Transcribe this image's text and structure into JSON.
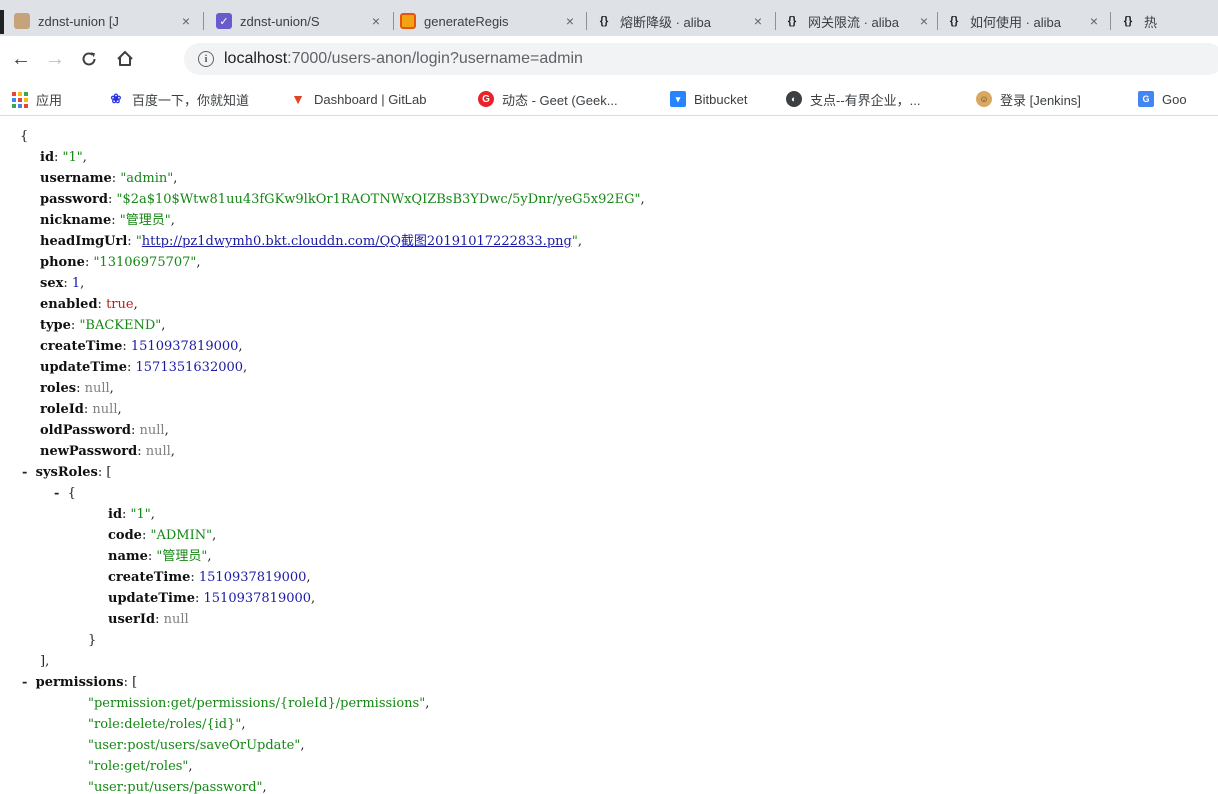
{
  "tabs": [
    {
      "title": "zdnst-union [J",
      "close": "×"
    },
    {
      "title": "zdnst-union/S",
      "close": "×"
    },
    {
      "title": "generateRegis",
      "close": "×"
    },
    {
      "title": "熔断降级 · aliba",
      "close": "×"
    },
    {
      "title": "网关限流 · aliba",
      "close": "×"
    },
    {
      "title": "如何使用 · aliba",
      "close": "×"
    },
    {
      "title": "热"
    }
  ],
  "toolbar": {
    "back_glyph": "←",
    "forward_glyph": "→",
    "reload_glyph": "C",
    "home_glyph": "⌂",
    "url_host": "localhost",
    "url_path": ":7000/users-anon/login?username=admin"
  },
  "bookmarks": [
    {
      "label": "应用",
      "icon": "apps-grid-icon"
    },
    {
      "label": "百度一下，你就知道",
      "icon": "baidu-paw-icon"
    },
    {
      "label": "Dashboard | GitLab",
      "icon": "gitlab-fox-icon"
    },
    {
      "label": "动态 - Geet (Geek...",
      "icon": "geet-icon"
    },
    {
      "label": "Bitbucket",
      "icon": "bitbucket-icon"
    },
    {
      "label": "支点--有界企业，...",
      "icon": "zhidian-icon"
    },
    {
      "label": "登录 [Jenkins]",
      "icon": "jenkins-icon"
    },
    {
      "label": "Goo",
      "icon": "google-translate-icon"
    }
  ],
  "json": {
    "open_brace": "{",
    "id_key": "id",
    "id_val": "\"1\"",
    "username_key": "username",
    "username_val": "\"admin\"",
    "password_key": "password",
    "password_val": "\"$2a$10$Wtw81uu43fGKw9lkOr1RAOTNWxQIZBsB3YDwc/5yDnr/yeG5x92EG\"",
    "nickname_key": "nickname",
    "nickname_val": "\"管理员\"",
    "headImgUrl_key": "headImgUrl",
    "headImgUrl_val": "http://pz1dwymh0.bkt.clouddn.com/QQ截图20191017222833.png",
    "phone_key": "phone",
    "phone_val": "\"13106975707\"",
    "sex_key": "sex",
    "sex_val": "1",
    "enabled_key": "enabled",
    "enabled_val": "true",
    "type_key": "type",
    "type_val": "\"BACKEND\"",
    "createTime_key": "createTime",
    "createTime_val": "1510937819000",
    "updateTime_key": "updateTime",
    "updateTime_val": "1571351632000",
    "roles_key": "roles",
    "roles_val": "null",
    "roleId_key": "roleId",
    "roleId_val": "null",
    "oldPassword_key": "oldPassword",
    "oldPassword_val": "null",
    "newPassword_key": "newPassword",
    "newPassword_val": "null",
    "sysRoles_key": "sysRoles",
    "role0": {
      "id_key": "id",
      "id_val": "\"1\"",
      "code_key": "code",
      "code_val": "\"ADMIN\"",
      "name_key": "name",
      "name_val": "\"管理员\"",
      "createTime_key": "createTime",
      "createTime_val": "1510937819000",
      "updateTime_key": "updateTime",
      "updateTime_val": "1510937819000",
      "userId_key": "userId",
      "userId_val": "null"
    },
    "permissions_key": "permissions",
    "permissions": [
      "\"permission:get/permissions/{roleId}/permissions\"",
      "\"role:delete/roles/{id}\"",
      "\"user:post/users/saveOrUpdate\"",
      "\"role:get/roles\"",
      "\"user:put/users/password\""
    ],
    "toggle_glyph": "-"
  }
}
